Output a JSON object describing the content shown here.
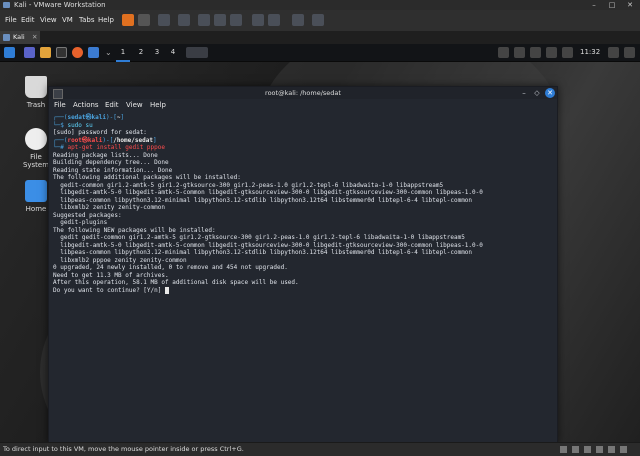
{
  "vmware": {
    "title": "Kali - VMware Workstation",
    "menu": [
      "File",
      "Edit",
      "View",
      "VM",
      "Tabs",
      "Help"
    ],
    "tab_label": "Kali",
    "win_min": "–",
    "win_max": "□",
    "win_close": "✕"
  },
  "panel": {
    "workspaces": [
      "1",
      "2",
      "3",
      "4"
    ],
    "clock": "11:32"
  },
  "desktop": {
    "icons": [
      "Trash",
      "File System",
      "Home"
    ]
  },
  "terminal": {
    "title": "root@kali: /home/sedat",
    "menu": [
      "File",
      "Actions",
      "Edit",
      "View",
      "Help"
    ],
    "btn_min": "–",
    "btn_max": "◇",
    "btn_close": "✕",
    "p1_open": "┌──(",
    "p1_user": "sedat㉿kali",
    "p1_mid": ")-[",
    "p1_dir": "~",
    "p1_close": "]",
    "p1_arrow": "└─$ ",
    "p1_cmd": "sudo su",
    "l_sudo": "[sudo] password for sedat:",
    "p2_open": "┌──(",
    "p2_user": "root㉿kali",
    "p2_mid": ")-[",
    "p2_dir": "/home/sedat",
    "p2_close": "]",
    "p2_arrow": "└─# ",
    "p2_cmd": "apt-get install gedit pppoe",
    "out": [
      "Reading package lists... Done",
      "Building dependency tree... Done",
      "Reading state information... Done",
      "The following additional packages will be installed:",
      "  gedit-common gir1.2-amtk-5 gir1.2-gtksource-300 gir1.2-peas-1.0 gir1.2-tepl-6 libadwaita-1-0 libappstream5",
      "  libgedit-amtk-5-0 libgedit-amtk-5-common libgedit-gtksourceview-300-0 libgedit-gtksourceview-300-common libpeas-1.0-0",
      "  libpeas-common libpython3.12-minimal libpython3.12-stdlib libpython3.12t64 libstemmer0d libtepl-6-4 libtepl-common",
      "  libxmlb2 zenity zenity-common",
      "Suggested packages:",
      "  gedit-plugins",
      "The following NEW packages will be installed:",
      "  gedit gedit-common gir1.2-amtk-5 gir1.2-gtksource-300 gir1.2-peas-1.0 gir1.2-tepl-6 libadwaita-1-0 libappstream5",
      "  libgedit-amtk-5-0 libgedit-amtk-5-common libgedit-gtksourceview-300-0 libgedit-gtksourceview-300-common libpeas-1.0-0",
      "  libpeas-common libpython3.12-minimal libpython3.12-stdlib libpython3.12t64 libstemmer0d libtepl-6-4 libtepl-common",
      "  libxmlb2 pppoe zenity zenity-common",
      "0 upgraded, 24 newly installed, 0 to remove and 454 not upgraded.",
      "Need to get 11.3 MB of archives.",
      "After this operation, 58.1 MB of additional disk space will be used.",
      "Do you want to continue? [Y/n] "
    ]
  },
  "status": "To direct input to this VM, move the mouse pointer inside or press Ctrl+G.",
  "colors": {
    "accent": "#2f7dd6",
    "prompt_user": "#ff4d4d",
    "prompt_path": "#4aa3df"
  }
}
